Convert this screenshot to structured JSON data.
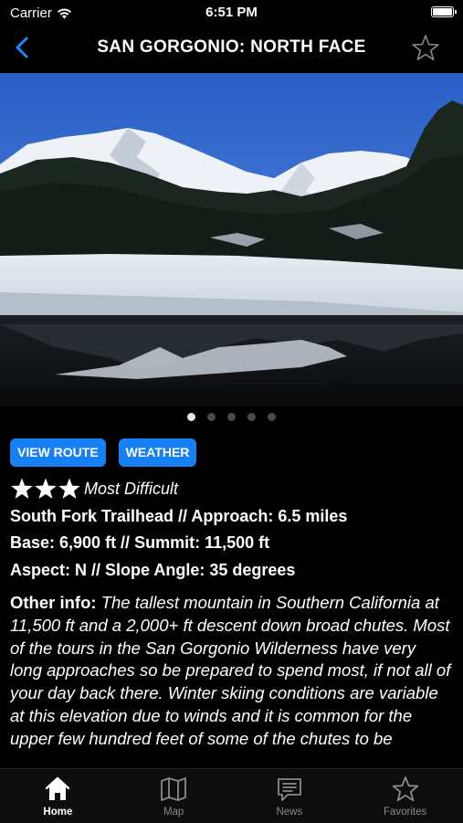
{
  "status": {
    "carrier": "Carrier",
    "time": "6:51 PM"
  },
  "nav": {
    "title": "SAN GORGONIO: NORTH FACE"
  },
  "gallery": {
    "page_count": 5,
    "current_page": 1
  },
  "buttons": {
    "view_route": "VIEW ROUTE",
    "weather": "WEATHER"
  },
  "rating": {
    "stars": 3,
    "label": "Most Difficult"
  },
  "details": {
    "trailhead": "South Fork Trailhead // Approach: 6.5 miles",
    "elevation": "Base: 6,900 ft // Summit: 11,500 ft",
    "aspect": "Aspect: N // Slope Angle: 35 degrees"
  },
  "other_info": {
    "label": "Other info:",
    "text": "The tallest mountain in Southern California at 11,500 ft and a 2,000+ ft descent down broad chutes. Most of the tours in the San Gorgonio Wilderness have very long approaches so be prepared to spend most, if not all of your day back there. Winter skiing conditions are variable at this elevation due to winds and it is common for the upper few hundred feet of some of the chutes to be"
  },
  "tabs": [
    {
      "label": "Home",
      "icon": "home-icon",
      "active": true
    },
    {
      "label": "Map",
      "icon": "map-icon",
      "active": false
    },
    {
      "label": "News",
      "icon": "news-icon",
      "active": false
    },
    {
      "label": "Favorites",
      "icon": "star-icon",
      "active": false
    }
  ],
  "colors": {
    "accent": "#1780F5",
    "background": "#000000",
    "tab_inactive": "#8A8A8A"
  }
}
